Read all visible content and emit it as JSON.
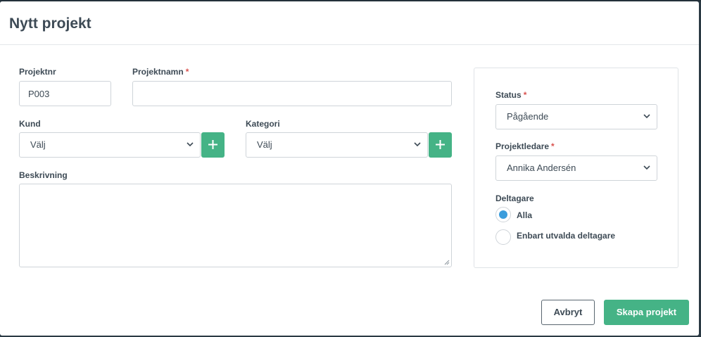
{
  "modal": {
    "title": "Nytt projekt"
  },
  "form": {
    "projektnr": {
      "label": "Projektnr",
      "value": "P003"
    },
    "projektnamn": {
      "label": "Projektnamn",
      "required_mark": "*",
      "value": ""
    },
    "kund": {
      "label": "Kund",
      "selected": "Välj",
      "add_icon": "plus-icon"
    },
    "kategori": {
      "label": "Kategori",
      "selected": "Välj",
      "add_icon": "plus-icon"
    },
    "beskrivning": {
      "label": "Beskrivning",
      "value": ""
    }
  },
  "panel": {
    "status": {
      "label": "Status",
      "required_mark": "*",
      "selected": "Pågående"
    },
    "projektledare": {
      "label": "Projektledare",
      "required_mark": "*",
      "selected": "Annika Andersén"
    },
    "deltagare": {
      "label": "Deltagare",
      "options": [
        {
          "label": "Alla",
          "checked": true
        },
        {
          "label": "Enbart utvalda deltagare",
          "checked": false
        }
      ]
    }
  },
  "footer": {
    "cancel_label": "Avbryt",
    "submit_label": "Skapa projekt"
  },
  "colors": {
    "accent": "#45b386",
    "radio_selected": "#3b9ddc",
    "required": "#d9534f"
  }
}
